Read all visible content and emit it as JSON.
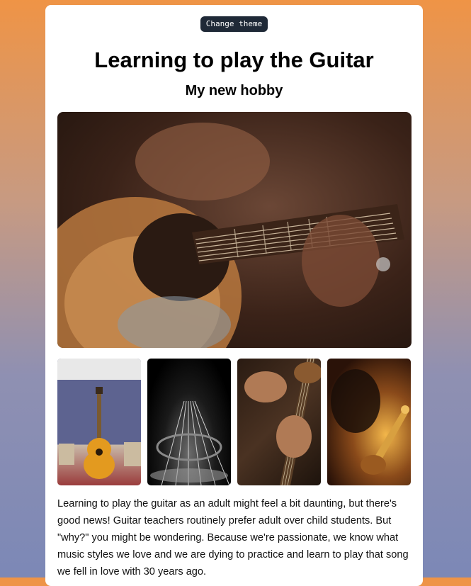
{
  "header": {
    "theme_button_label": "Change theme",
    "title": "Learning to play the Guitar",
    "subtitle": "My new hobby"
  },
  "images": {
    "hero": "guitar-closeup-image",
    "thumbnails": [
      "guitar-against-wall-image",
      "guitar-strings-closeup-image",
      "hands-playing-guitar-image",
      "guitarist-warm-light-image"
    ]
  },
  "content": {
    "paragraph": "Learning to play the guitar as an adult might feel a bit daunting, but there's good news! Guitar teachers routinely prefer adult over child students. But \"why?\" you might be wondering. Because we're passionate, we know what music styles we love and we are dying to practice and learn to play that song we fell in love with 30 years ago."
  }
}
